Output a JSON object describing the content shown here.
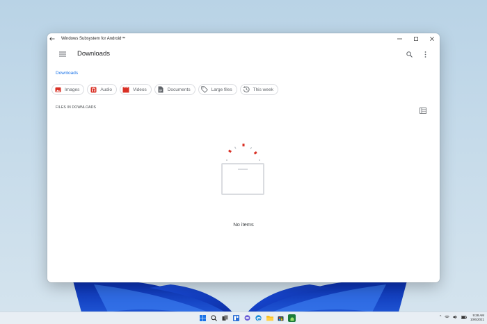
{
  "window": {
    "title": "Windows Subsystem for Android™",
    "controls": [
      "minimize",
      "maximize",
      "close"
    ]
  },
  "appbar": {
    "title": "Downloads",
    "menu_icon": "hamburger-menu-icon",
    "search_icon": "search-icon",
    "more_icon": "more-vert-icon"
  },
  "breadcrumb": "Downloads",
  "chips": [
    {
      "label": "Images",
      "icon": "image-icon",
      "color": "#d93025"
    },
    {
      "label": "Audio",
      "icon": "audio-icon",
      "color": "#d93025"
    },
    {
      "label": "Videos",
      "icon": "video-icon",
      "color": "#d93025"
    },
    {
      "label": "Documents",
      "icon": "document-icon",
      "color": "#5f6368"
    },
    {
      "label": "Large files",
      "icon": "tag-icon",
      "color": "#5f6368"
    },
    {
      "label": "This week",
      "icon": "history-icon",
      "color": "#5f6368"
    }
  ],
  "section": {
    "header": "FILES IN DOWNLOADS",
    "view_icon": "list-view-icon"
  },
  "empty": {
    "text": "No items"
  },
  "accent": "#1a73e8",
  "taskbar": {
    "icons": [
      "windows-start-icon",
      "search-icon",
      "task-view-icon",
      "widgets-icon",
      "chat-icon",
      "edge-icon",
      "file-explorer-icon",
      "store-icon",
      "android-icon"
    ],
    "tray": {
      "chevron": "^",
      "time": "9:28 AM",
      "date": "10/6/2021"
    }
  }
}
